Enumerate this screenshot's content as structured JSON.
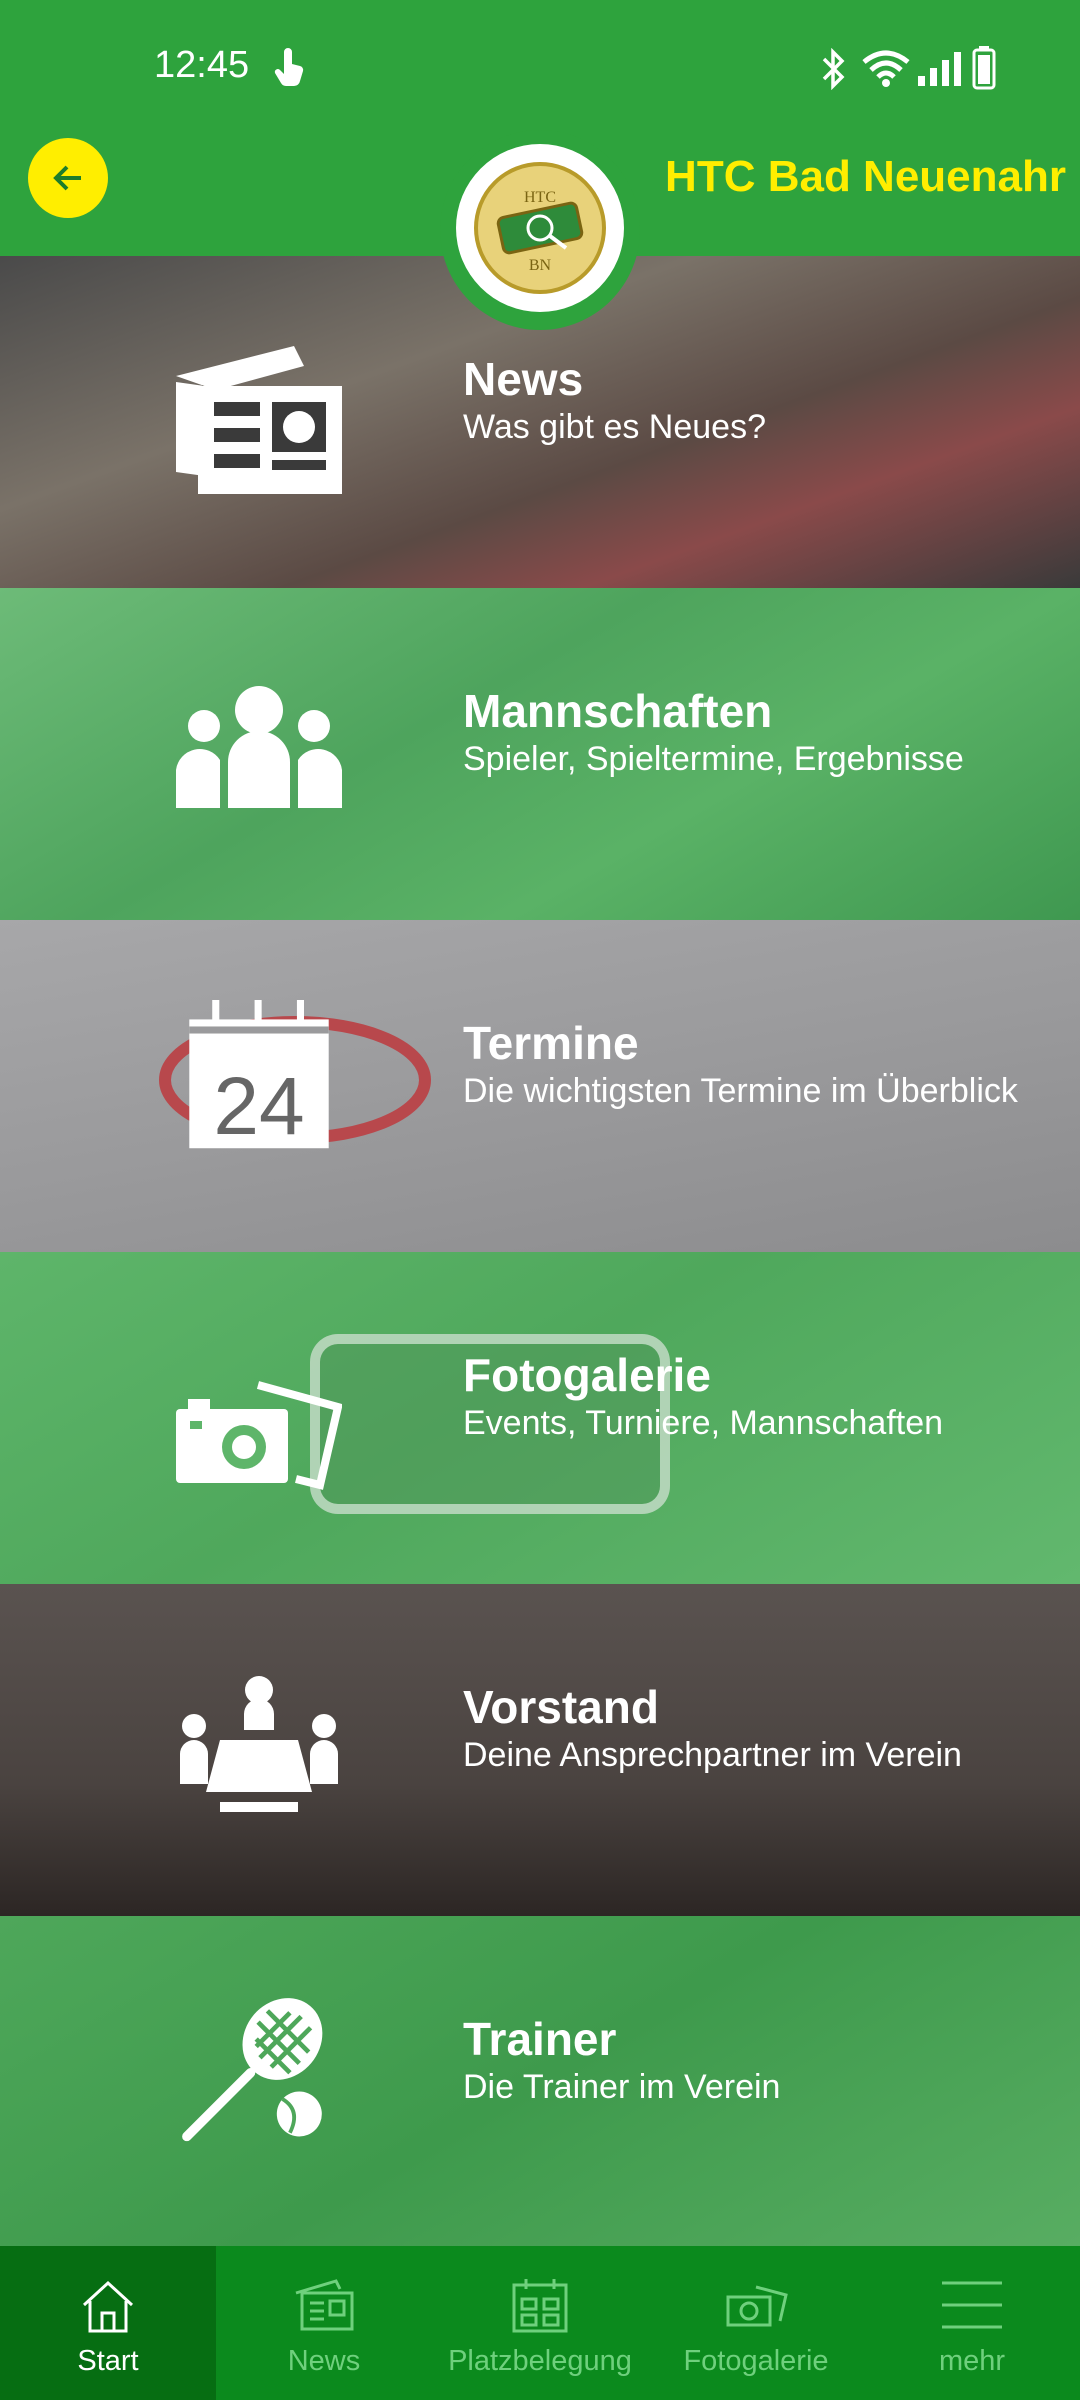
{
  "status_bar": {
    "time": "12:45"
  },
  "header": {
    "title": "HTC Bad Neuenahr",
    "logo_text": "HTC BN"
  },
  "tiles": [
    {
      "title": "News",
      "subtitle": "Was gibt es Neues?",
      "icon": "newspaper-icon"
    },
    {
      "title": "Mannschaften",
      "subtitle": "Spieler, Spieltermine, Ergebnisse",
      "icon": "team-icon"
    },
    {
      "title": "Termine",
      "subtitle": "Die wichtigsten Termine im Überblick",
      "icon": "calendar-icon",
      "calendar_day": "24"
    },
    {
      "title": "Fotogalerie",
      "subtitle": "Events, Turniere, Mannschaften",
      "icon": "camera-icon"
    },
    {
      "title": "Vorstand",
      "subtitle": "Deine Ansprechpartner im Verein",
      "icon": "meeting-icon"
    },
    {
      "title": "Trainer",
      "subtitle": "Die Trainer im Verein",
      "icon": "tennis-racket-icon"
    }
  ],
  "bottom_nav": [
    {
      "label": "Start",
      "icon": "home-icon",
      "active": true
    },
    {
      "label": "News",
      "icon": "newspaper-icon",
      "active": false
    },
    {
      "label": "Platzbelegung",
      "icon": "calendar-grid-icon",
      "active": false
    },
    {
      "label": "Fotogalerie",
      "icon": "camera-icon",
      "active": false
    },
    {
      "label": "mehr",
      "icon": "menu-icon",
      "active": false
    }
  ],
  "colors": {
    "primary_green": "#2ea33d",
    "accent_yellow": "#ffee00",
    "nav_bg": "#0b8a1d",
    "nav_active": "#066e12"
  }
}
